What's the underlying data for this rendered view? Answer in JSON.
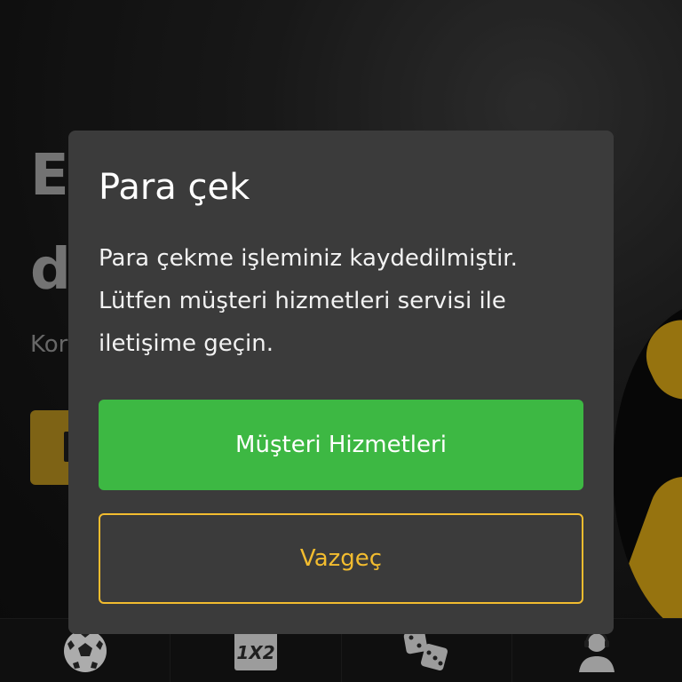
{
  "background": {
    "hero_line1": "E",
    "hero_line2": "d",
    "hero_sub": "Kor"
  },
  "modal": {
    "title": "Para çek",
    "message": "Para çekme işleminiz kaydedilmiştir. Lütfen müşteri hizmetleri servisi ile iletişime geçin.",
    "primary_button": "Müşteri Hizmetleri",
    "secondary_button": "Vazgeç"
  },
  "bottom_nav": {
    "items": [
      {
        "icon": "soccer-ball-icon"
      },
      {
        "icon": "1x2-icon",
        "label": "1X2"
      },
      {
        "icon": "dice-icon"
      },
      {
        "icon": "support-agent-icon"
      }
    ]
  },
  "colors": {
    "modal_bg": "#3b3b3b",
    "primary": "#3db843",
    "accent": "#f2bc2f",
    "hero_button": "#a8841c"
  }
}
